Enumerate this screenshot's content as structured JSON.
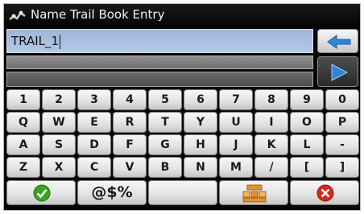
{
  "window": {
    "title": "Name Trail Book Entry",
    "logo_icon": "route-logo-icon"
  },
  "input": {
    "value": "TRAIL_1"
  },
  "side_buttons": {
    "backspace_icon": "backspace-arrow-icon",
    "next_icon": "play-arrow-icon"
  },
  "keyboard": {
    "rows": [
      [
        "1",
        "2",
        "3",
        "4",
        "5",
        "6",
        "7",
        "8",
        "9",
        "0"
      ],
      [
        "Q",
        "W",
        "E",
        "R",
        "T",
        "Y",
        "U",
        "I",
        "O",
        "P"
      ],
      [
        "A",
        "S",
        "D",
        "F",
        "G",
        "H",
        "J",
        "K",
        "L",
        "-"
      ],
      [
        "Z",
        "X",
        "C",
        "V",
        "B",
        "N",
        "M",
        "/",
        "[",
        "]"
      ]
    ],
    "bottom": {
      "ok_icon": "checkmark-icon",
      "symbols_label": "@$%",
      "space_label": "",
      "keyboard_layout_icon": "keyboard-layout-icon",
      "cancel_icon": "cancel-icon"
    }
  },
  "colors": {
    "accent_blue": "#2f86d6",
    "ok_green": "#3aa51f",
    "cancel_red": "#d7281e"
  }
}
